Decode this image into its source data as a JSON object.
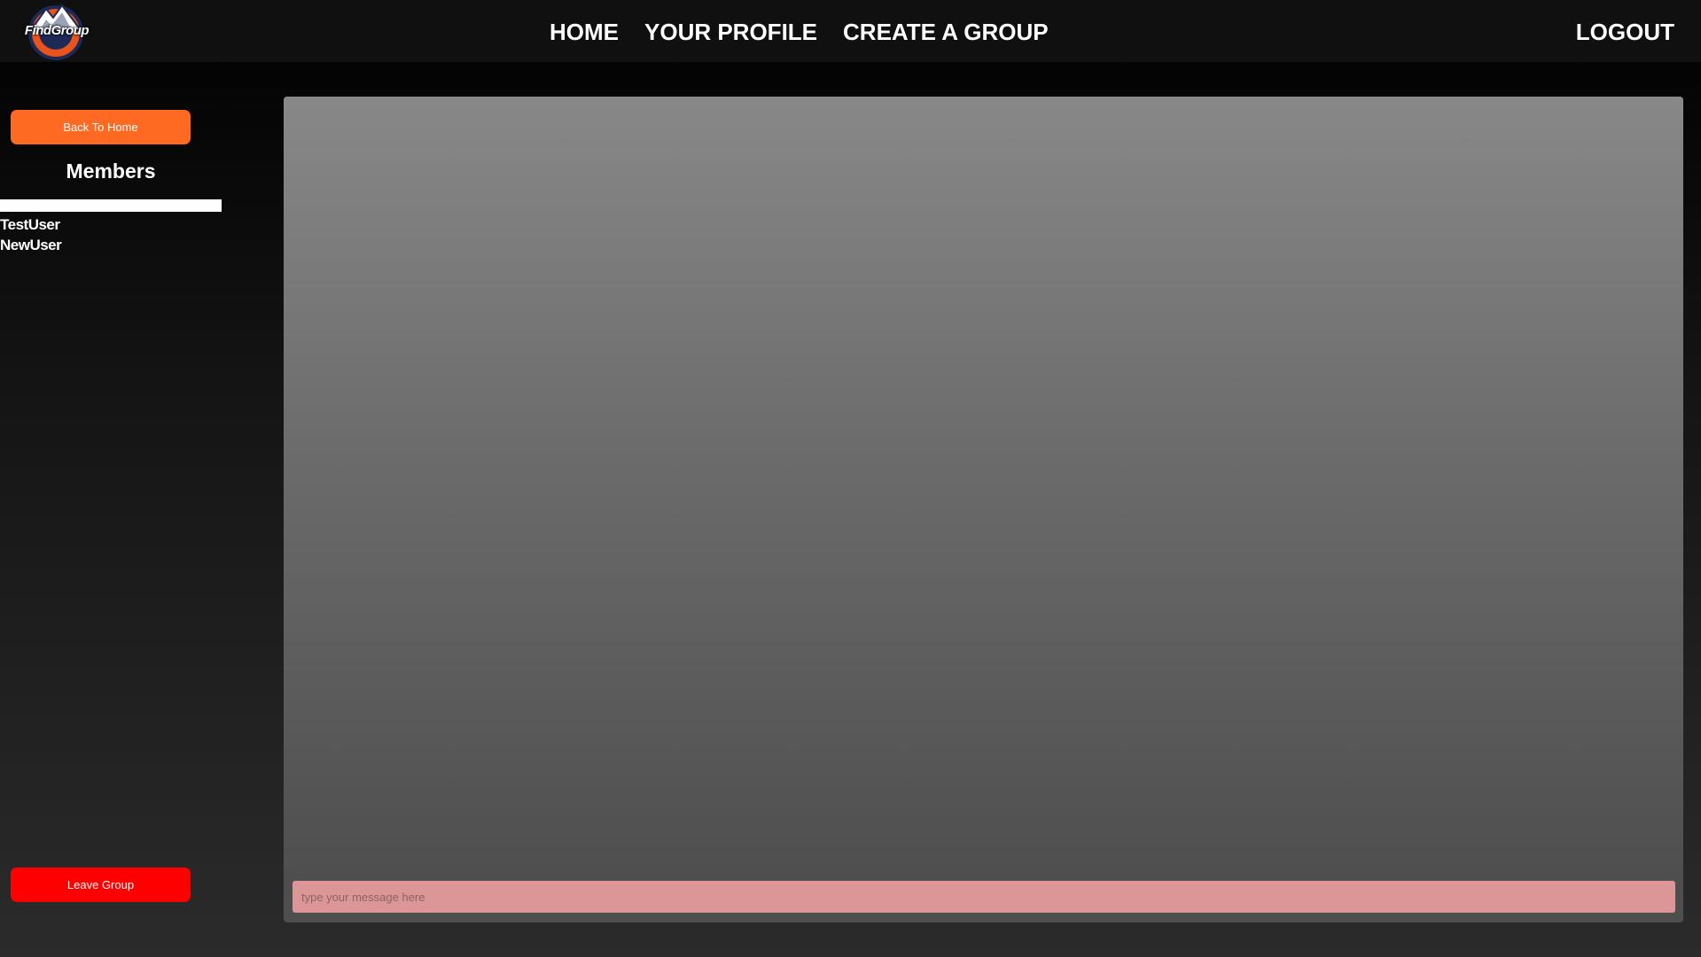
{
  "navbar": {
    "logo_text": "FindGroup",
    "links": [
      "HOME",
      "YOUR PROFILE",
      "CREATE A GROUP"
    ],
    "logout_label": "LOGOUT"
  },
  "sidebar": {
    "back_button": "Back To Home",
    "members_title": "Members",
    "members": [
      "TestUser",
      "NewUser"
    ],
    "leave_button": "Leave Group"
  },
  "chat": {
    "input_placeholder": "type your message here",
    "input_value": ""
  },
  "colors": {
    "accent_orange": "#ff6a22",
    "leave_red": "#ff0000",
    "input_pink": "#dc9697"
  }
}
